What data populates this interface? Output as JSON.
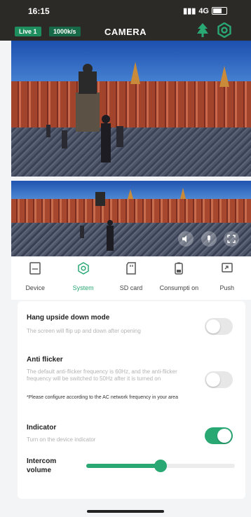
{
  "status_bar": {
    "time": "16:15",
    "signal": "4G"
  },
  "header": {
    "live_badge": "Live 1",
    "speed_badge": "1000k/s",
    "title": "CAMERA"
  },
  "tabs": [
    {
      "label": "Device",
      "icon": "device-icon",
      "active": false
    },
    {
      "label": "System",
      "icon": "system-icon",
      "active": true
    },
    {
      "label": "SD card",
      "icon": "sd-card-icon",
      "active": false
    },
    {
      "label": "Consumpti on",
      "icon": "battery-icon",
      "active": false
    },
    {
      "label": "Push",
      "icon": "push-icon",
      "active": false
    }
  ],
  "settings": {
    "hang_upside": {
      "title": "Hang upside down mode",
      "desc": "The screen will flip up and down after opening",
      "enabled": false
    },
    "anti_flicker": {
      "title": "Anti flicker",
      "desc": "The default anti-flicker frequency is 60Hz, and the anti-flicker frequency will be switched to 50Hz after it is turned on",
      "note": "*Please configure according to the AC network frequency in your area",
      "enabled": false
    },
    "indicator": {
      "title": "Indicator",
      "desc": "Turn on the device indicator",
      "enabled": true
    },
    "intercom": {
      "title": "Intercom volume",
      "level": 0.5
    }
  },
  "colors": {
    "accent": "#2aa874",
    "topbar": "#2b2a27"
  }
}
